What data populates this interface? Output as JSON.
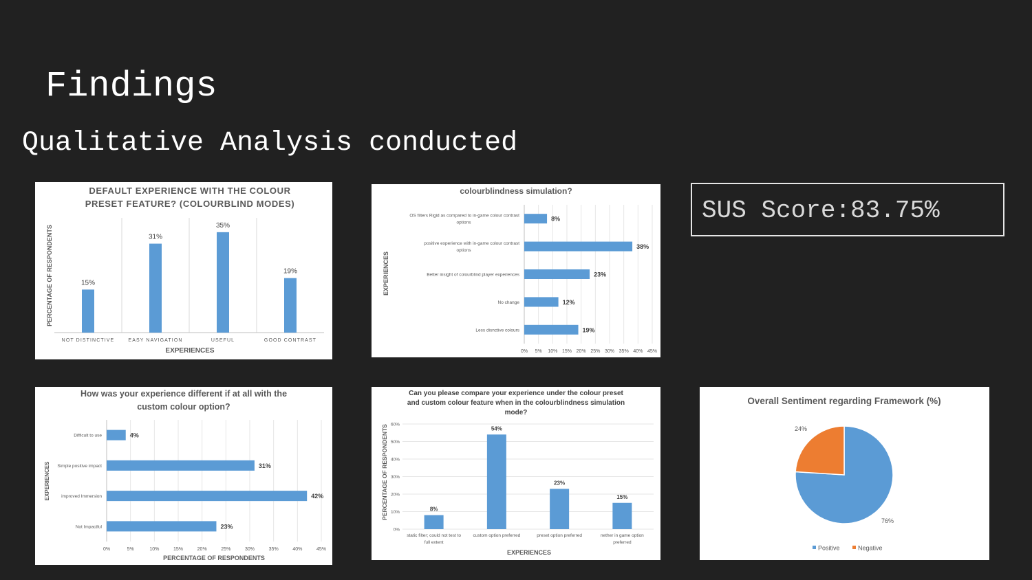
{
  "slide": {
    "title": "Findings",
    "subtitle": "Qualitative Analysis conducted",
    "sus_score": "SUS Score:83.75%"
  },
  "colors": {
    "background": "#212121",
    "bar": "#5b9bd5",
    "positive": "#5b9bd5",
    "negative": "#ed7d31"
  },
  "chart_data": [
    {
      "id": "chart1",
      "type": "bar",
      "title_lines": [
        "DEFAULT EXPERIENCE WITH THE COLOUR",
        "PRESET FEATURE? (COLOURBLIND MODES)"
      ],
      "xlabel": "EXPERIENCES",
      "ylabel": "PERCENTAGE OF RESPONDENTS",
      "categories": [
        "NOT DISTINCTIVE",
        "EASY NAVIGATION",
        "USEFUL",
        "GOOD CONTRAST"
      ],
      "values": [
        15,
        31,
        35,
        19
      ],
      "labels": [
        "15%",
        "31%",
        "35%",
        "19%"
      ],
      "ylim": [
        0,
        40
      ],
      "grid": "vertical separators"
    },
    {
      "id": "chart2",
      "type": "bar",
      "orientation": "horizontal",
      "title_lines": [
        "colourblindness simulation?"
      ],
      "ylabel": "EXPERIENCES",
      "categories": [
        [
          "OS filters Rigid as compared to in-game colour contrast",
          "options"
        ],
        [
          "positive experience with in-game colour contrast",
          "options"
        ],
        [
          "Better insight of colourblind player experiences"
        ],
        [
          "No change"
        ],
        [
          "Less disnctive colours"
        ]
      ],
      "values": [
        8,
        38,
        23,
        12,
        19
      ],
      "labels": [
        "8%",
        "38%",
        "23%",
        "12%",
        "19%"
      ],
      "ticks": [
        "0%",
        "5%",
        "10%",
        "15%",
        "20%",
        "25%",
        "30%",
        "35%",
        "40%",
        "45%"
      ],
      "xlim": [
        0,
        45
      ],
      "grid": true
    },
    {
      "id": "chart3",
      "type": "bar",
      "orientation": "horizontal",
      "title_lines": [
        "How was your experience different if at all with the",
        "custom colour option?"
      ],
      "ylabel": "EXPERIENCES",
      "xlabel": "PERCENTAGE OF RESPONDENTS",
      "categories": [
        [
          "Difficult to use"
        ],
        [
          "Simple positive impact"
        ],
        [
          "improved Immersion"
        ],
        [
          "Not Impactful"
        ]
      ],
      "values": [
        4,
        31,
        42,
        23
      ],
      "labels": [
        "4%",
        "31%",
        "42%",
        "23%"
      ],
      "ticks": [
        "0%",
        "5%",
        "10%",
        "15%",
        "20%",
        "25%",
        "30%",
        "35%",
        "40%",
        "45%"
      ],
      "xlim": [
        0,
        45
      ],
      "grid": true
    },
    {
      "id": "chart4",
      "type": "bar",
      "title_lines": [
        "Can you please compare your experience under the colour preset",
        "and custom colour feature when in the colourblindness simulation",
        "mode?"
      ],
      "xlabel": "EXPERIENCES",
      "ylabel": "PERCENTAGE OF RESPONDENTS",
      "categories": [
        [
          "static filter; could not test to",
          "full extent"
        ],
        [
          "custom option preferred"
        ],
        [
          "preset option preferred"
        ],
        [
          "nether in game option",
          "preferred"
        ]
      ],
      "values": [
        8,
        54,
        23,
        15
      ],
      "labels": [
        "8%",
        "54%",
        "23%",
        "15%"
      ],
      "ticks": [
        "0%",
        "10%",
        "20%",
        "30%",
        "40%",
        "50%",
        "60%"
      ],
      "ylim": [
        0,
        60
      ],
      "grid": true
    },
    {
      "id": "chart5",
      "type": "pie",
      "title_lines": [
        "Overall Sentiment regarding Framework (%)"
      ],
      "slices": [
        {
          "name": "Positive",
          "value": 76,
          "label": "76%"
        },
        {
          "name": "Negative",
          "value": 24,
          "label": "24%"
        }
      ],
      "legend": "bottom"
    }
  ]
}
